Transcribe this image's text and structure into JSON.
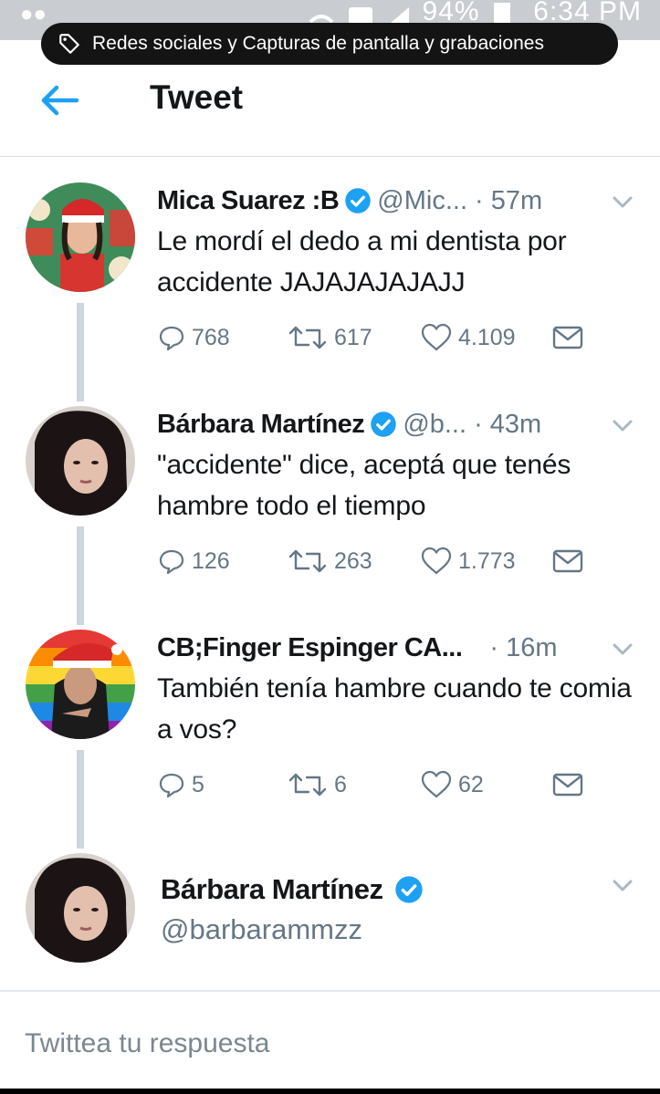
{
  "status_bar": {
    "battery": "94%",
    "time": "6:34 PM"
  },
  "toast": {
    "text": "Redes sociales y Capturas de pantalla y grabaciones",
    "icon": "tag-icon"
  },
  "header": {
    "title": "Tweet",
    "back_icon": "arrow-left-icon"
  },
  "tweets": [
    {
      "name": "Mica Suarez :B",
      "verified": true,
      "handle": "@Mic...",
      "time": "· 57m",
      "text": "Le mordí el dedo a mi dentista por accidente JAJAJAJAJAJJ",
      "replies": "768",
      "retweets": "617",
      "likes": "4.109"
    },
    {
      "name": "Bárbara Martínez",
      "verified": true,
      "handle": "@b...",
      "time": "· 43m",
      "text": "\"accidente\" dice, aceptá que tenés hambre todo el tiempo",
      "replies": "126",
      "retweets": "263",
      "likes": "1.773"
    },
    {
      "name": "CB;Finger Espinger CA...",
      "verified": false,
      "handle": "",
      "time": "· 16m",
      "text": "También tenía hambre cuando te comia a vos?",
      "replies": "5",
      "retweets": "6",
      "likes": "62"
    }
  ],
  "main_tweet": {
    "name": "Bárbara Martínez",
    "verified": true,
    "handle": "@barbarammzz"
  },
  "reply": {
    "placeholder": "Twittea tu respuesta"
  },
  "colors": {
    "accent": "#1da1f2",
    "text": "#14171a",
    "secondary": "#657786",
    "thread_line": "#ccd6dd"
  }
}
